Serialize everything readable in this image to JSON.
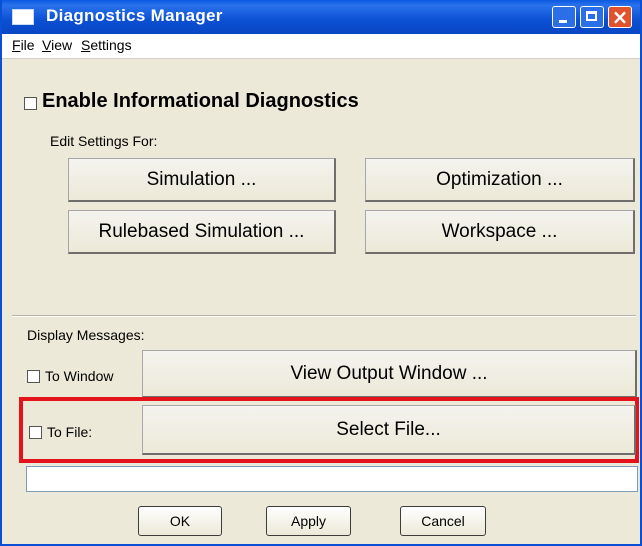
{
  "window": {
    "title": "Diagnostics  Manager",
    "controls": {
      "minimize": "–",
      "maximize": "□",
      "close": "×"
    }
  },
  "menu": {
    "file": {
      "mnemonic": "F",
      "rest": "ile"
    },
    "view": {
      "mnemonic": "V",
      "rest": "iew"
    },
    "settings": {
      "mnemonic": "S",
      "rest": "ettings"
    }
  },
  "enable": {
    "label": "Enable Informational Diagnostics",
    "checked": false
  },
  "edit_settings": {
    "label": "Edit Settings For:",
    "buttons": {
      "simulation": "Simulation ...",
      "optimization": "Optimization ...",
      "rulebased": "Rulebased Simulation ...",
      "workspace": "Workspace ..."
    }
  },
  "display": {
    "label": "Display Messages:",
    "to_window": {
      "label": "To Window",
      "checked": false,
      "button": "View Output Window ..."
    },
    "to_file": {
      "label": "To File:",
      "checked": false,
      "button": "Select File..."
    },
    "file_path": {
      "value": ""
    }
  },
  "footer": {
    "ok": "OK",
    "apply": "Apply",
    "cancel": "Cancel"
  },
  "colors": {
    "highlight": "#e3151a",
    "titlebar": "#0b4fd3",
    "face": "#ece9d8"
  }
}
